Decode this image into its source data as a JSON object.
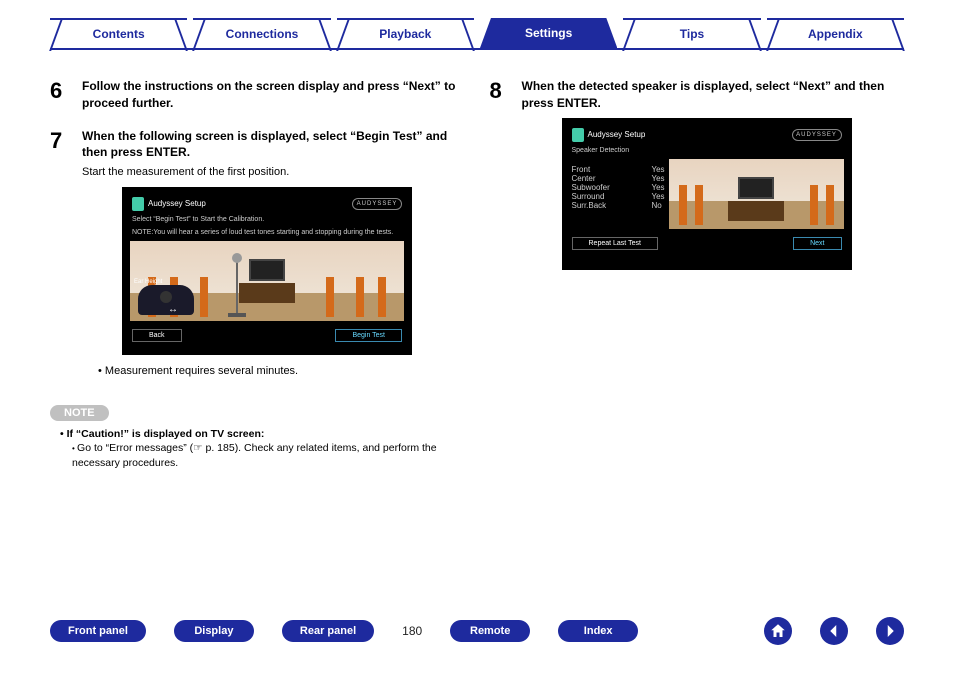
{
  "tabs": {
    "contents": "Contents",
    "connections": "Connections",
    "playback": "Playback",
    "settings": "Settings",
    "tips": "Tips",
    "appendix": "Appendix"
  },
  "steps": {
    "s6": {
      "num": "6",
      "title": "Follow the instructions on the screen display and press “Next” to proceed further."
    },
    "s7": {
      "num": "7",
      "title": "When the following screen is displayed, select “Begin Test” and then press ENTER.",
      "sub": "Start the measurement of the first position.",
      "bullet": "Measurement requires several minutes."
    },
    "s8": {
      "num": "8",
      "title": "When the detected speaker is displayed, select “Next” and then press ENTER."
    }
  },
  "note": {
    "label": "NOTE",
    "line1": "If “Caution!” is displayed on TV screen:",
    "line2a": "Go to “Error messages” (",
    "line2b": " p. 185). Check any related items, and perform the necessary procedures."
  },
  "shot1": {
    "header": "Audyssey Setup",
    "logo": "AUDYSSEY",
    "inst1": "Select “Begin Test” to Start the Calibration.",
    "inst2": "NOTE:You will hear a series of loud test tones starting and stopping during the tests.",
    "ear": "Ear Height",
    "back": "Back",
    "begin": "Begin Test"
  },
  "shot2": {
    "header": "Audyssey Setup",
    "logo": "AUDYSSEY",
    "subhead": "Speaker Detection",
    "rows": {
      "front": {
        "k": "Front",
        "v": "Yes"
      },
      "center": {
        "k": "Center",
        "v": "Yes"
      },
      "sub": {
        "k": "Subwoofer",
        "v": "Yes"
      },
      "surr": {
        "k": "Surround",
        "v": "Yes"
      },
      "sb": {
        "k": "Surr.Back",
        "v": "No"
      }
    },
    "repeat": "Repeat Last Test",
    "next": "Next"
  },
  "bottom": {
    "front_panel": "Front panel",
    "display": "Display",
    "rear_panel": "Rear panel",
    "remote": "Remote",
    "index": "Index",
    "page": "180"
  }
}
